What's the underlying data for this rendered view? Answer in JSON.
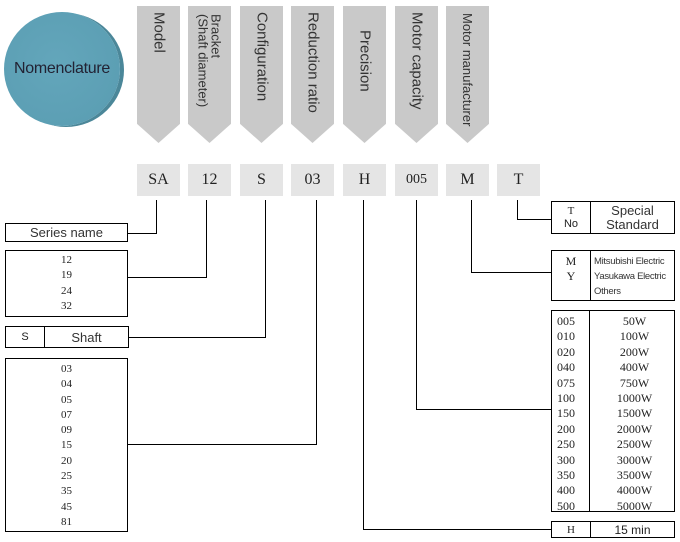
{
  "title": "Nomenclature",
  "columns": [
    {
      "label": "Model",
      "code": "SA"
    },
    {
      "label": "Bracket\n(Shaft diameter)",
      "label_line1": "Bracket",
      "label_line2": "(Shaft diameter)",
      "code": "12"
    },
    {
      "label": "Configuration",
      "code": "S"
    },
    {
      "label": "Reduction ratio",
      "code": "03"
    },
    {
      "label": "Precision",
      "code": "H"
    },
    {
      "label": "Motor capacity",
      "code": "005"
    },
    {
      "label": "Motor manufacturer",
      "code": "M"
    },
    {
      "label": "",
      "code": "T"
    }
  ],
  "series": {
    "label": "Series name"
  },
  "bracket": {
    "options": [
      "12",
      "19",
      "24",
      "32"
    ]
  },
  "configuration": {
    "code": "S",
    "label": "Shaft"
  },
  "reduction_ratio": {
    "options": [
      "03",
      "04",
      "05",
      "07",
      "09",
      "15",
      "20",
      "25",
      "35",
      "45",
      "81"
    ]
  },
  "special": {
    "codes": [
      "T",
      "No"
    ],
    "labels": [
      "Special",
      "Standard"
    ]
  },
  "manufacturer": {
    "codes": [
      "M",
      "Y"
    ],
    "labels": [
      "Mitsubishi Electric",
      "Yasukawa Electric",
      "Others"
    ]
  },
  "motor_capacity": {
    "rows": [
      {
        "code": "005",
        "watts": "50W"
      },
      {
        "code": "010",
        "watts": "100W"
      },
      {
        "code": "020",
        "watts": "200W"
      },
      {
        "code": "040",
        "watts": "400W"
      },
      {
        "code": "075",
        "watts": "750W"
      },
      {
        "code": "100",
        "watts": "1000W"
      },
      {
        "code": "150",
        "watts": "1500W"
      },
      {
        "code": "200",
        "watts": "2000W"
      },
      {
        "code": "250",
        "watts": "2500W"
      },
      {
        "code": "300",
        "watts": "3000W"
      },
      {
        "code": "350",
        "watts": "3500W"
      },
      {
        "code": "400",
        "watts": "4000W"
      },
      {
        "code": "500",
        "watts": "5000W"
      }
    ]
  },
  "precision": {
    "code": "H",
    "label": "15 min"
  },
  "colors": {
    "circle": "#5fa3b8",
    "arrow": "#c9c9c9",
    "code_box": "#e5e5e5"
  }
}
